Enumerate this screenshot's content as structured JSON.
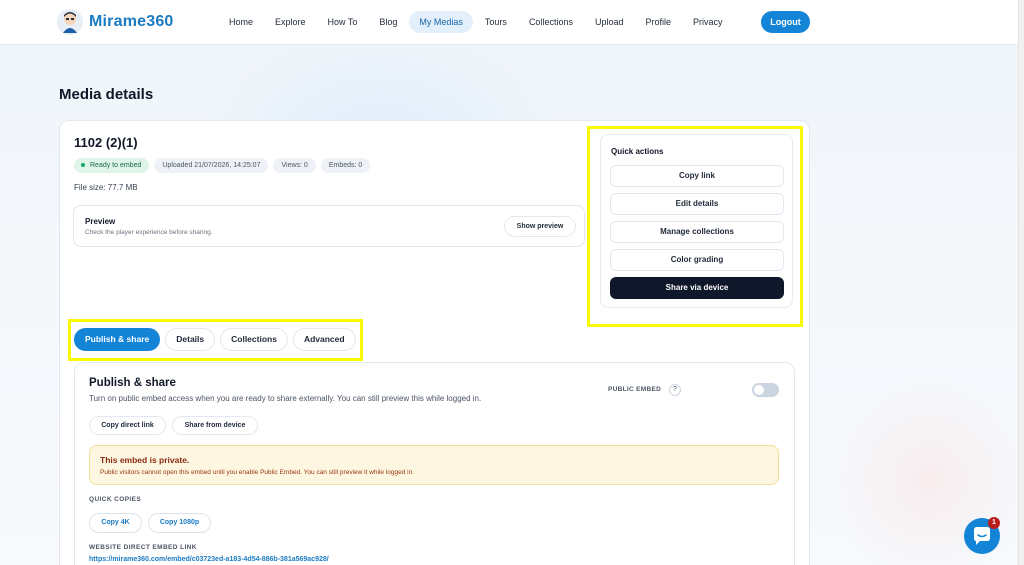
{
  "nav": {
    "brand": "Mirame360",
    "links": [
      "Home",
      "Explore",
      "How To",
      "Blog",
      "My Medias",
      "Tours",
      "Collections",
      "Upload",
      "Profile",
      "Privacy"
    ],
    "active": "My Medias",
    "logout": "Logout"
  },
  "page_title": "Media details",
  "media": {
    "title": "1102 (2)(1)",
    "status": "Ready to embed",
    "uploaded": "Uploaded 21/07/2026, 14:25:07",
    "views": "Views: 0",
    "embeds": "Embeds: 0",
    "file_size": "File size: 77.7 MB"
  },
  "preview": {
    "title": "Preview",
    "subtitle": "Check the player experience before sharing.",
    "button": "Show preview"
  },
  "quick_actions": {
    "title": "Quick actions",
    "buttons": [
      "Copy link",
      "Edit details",
      "Manage collections",
      "Color grading",
      "Share via device"
    ]
  },
  "tabs": [
    "Publish & share",
    "Details",
    "Collections",
    "Advanced"
  ],
  "publish": {
    "title": "Publish & share",
    "subtitle": "Turn on public embed access when you are ready to share externally. You can still preview this while logged in.",
    "public_embed_label": "PUBLIC EMBED",
    "help": "?",
    "public_embed_enabled": false,
    "copy_direct_link": "Copy direct link",
    "share_from_device": "Share from device",
    "warning_title": "This embed is private.",
    "warning_text": "Public visitors cannot open this embed until you enable Public Embed. You can still preview it while logged in.",
    "quick_copies_label": "QUICK COPIES",
    "copy_4k": "Copy 4K",
    "copy_1080p": "Copy 1080p",
    "embed_link_label": "WEBSITE DIRECT EMBED LINK",
    "embed_link": "https://mirame360.com/embed/c03723ed-a183-4d54-886b-381a569ac928/"
  },
  "chat": {
    "badge": "1"
  },
  "colors": {
    "accent": "#1484d6",
    "highlight": "#f9f900",
    "dark_button": "#0f172a"
  }
}
